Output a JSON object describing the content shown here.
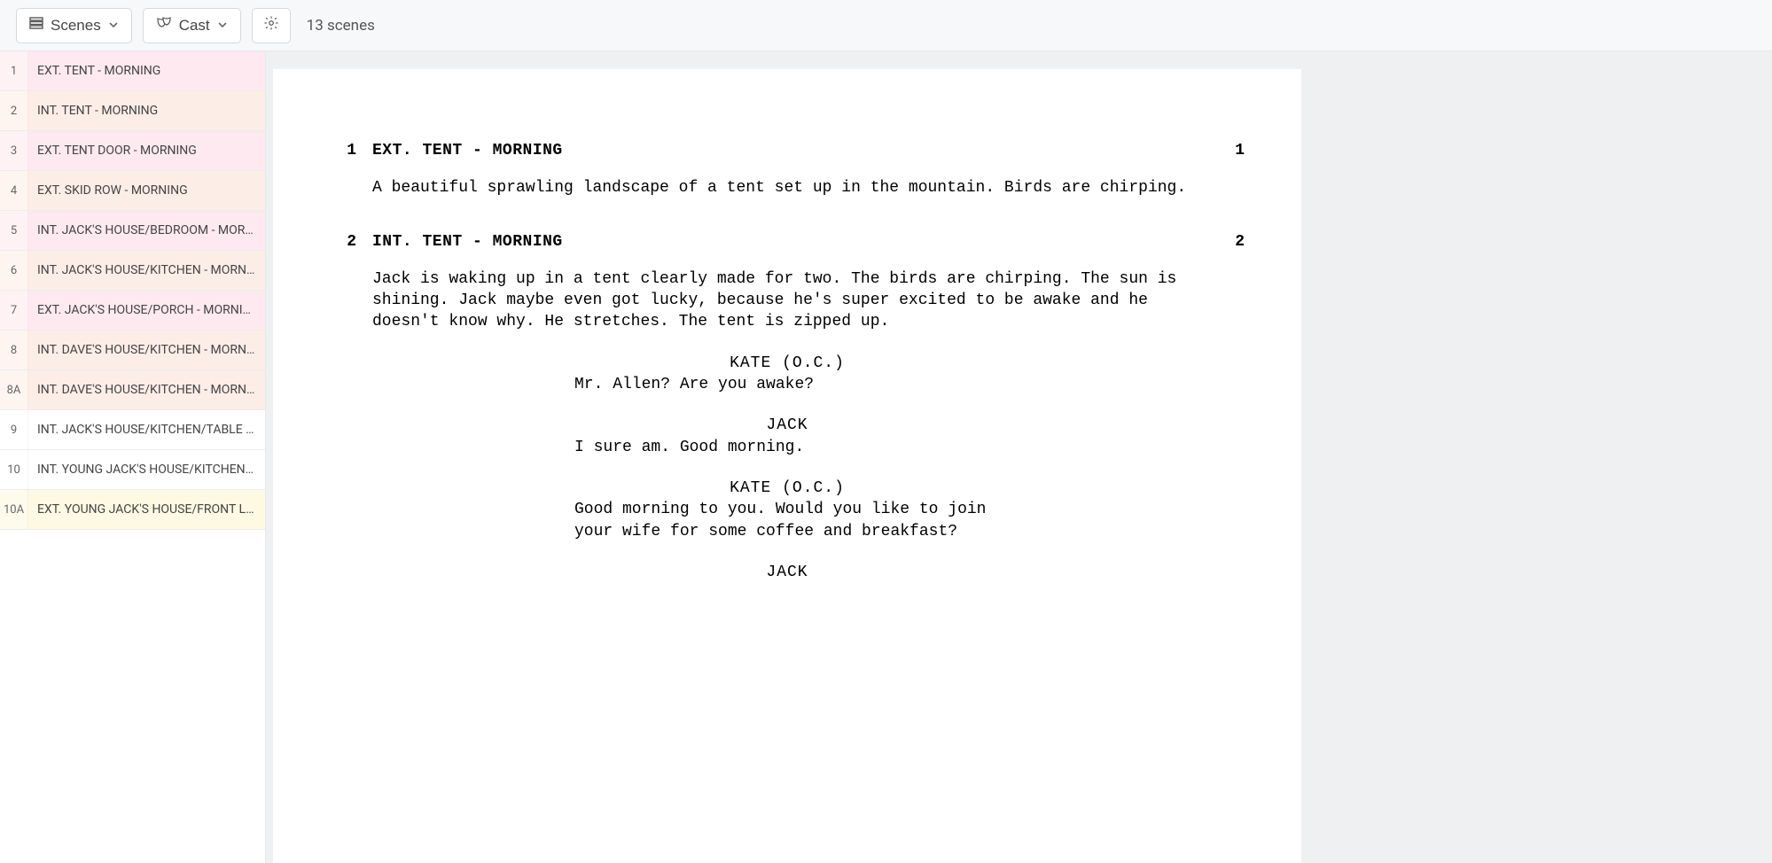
{
  "toolbar": {
    "scenes_label": "Scenes",
    "cast_label": "Cast",
    "scene_count": "13 scenes"
  },
  "sidebar": {
    "scenes": [
      {
        "num": "1",
        "title": "EXT. TENT - MORNING",
        "tint": "tint-pink-1"
      },
      {
        "num": "2",
        "title": "INT. TENT - MORNING",
        "tint": "tint-pink-2"
      },
      {
        "num": "3",
        "title": "EXT. TENT DOOR - MORNING",
        "tint": "tint-pink-1"
      },
      {
        "num": "4",
        "title": "EXT. SKID ROW - MORNING",
        "tint": "tint-pink-2"
      },
      {
        "num": "5",
        "title": "INT. JACK'S HOUSE/BEDROOM - MORNING",
        "tint": "tint-pink-1"
      },
      {
        "num": "6",
        "title": "INT. JACK'S HOUSE/KITCHEN - MORNING",
        "tint": "tint-pink-2"
      },
      {
        "num": "7",
        "title": "EXT. JACK'S HOUSE/PORCH - MORNING",
        "tint": "tint-pink-1"
      },
      {
        "num": "8",
        "title": "INT. DAVE'S HOUSE/KITCHEN - MORNING",
        "tint": "tint-pink-2"
      },
      {
        "num": "8A",
        "title": "INT. DAVE'S HOUSE/KITCHEN - MORNING",
        "tint": "tint-pink-2"
      },
      {
        "num": "9",
        "title": "INT. JACK'S HOUSE/KITCHEN/TABLE - DAY",
        "tint": "tint-white"
      },
      {
        "num": "10",
        "title": "INT. YOUNG JACK'S HOUSE/KITCHEN/TABLE - …",
        "tint": "tint-white"
      },
      {
        "num": "10A",
        "title": "EXT. YOUNG JACK'S HOUSE/FRONT LAWN - D…",
        "tint": "tint-yellow"
      }
    ]
  },
  "script": {
    "scenes": [
      {
        "num": "1",
        "slug": "EXT. TENT - MORNING",
        "content": [
          {
            "type": "action",
            "text": "A beautiful sprawling landscape of a tent set up in the mountain. Birds are chirping."
          }
        ]
      },
      {
        "num": "2",
        "slug": "INT. TENT - MORNING",
        "content": [
          {
            "type": "action",
            "text": "Jack is waking up in a tent clearly made for two. The birds are chirping. The sun is shining. Jack maybe even got lucky, because he's super excited to be awake and he doesn't know why. He stretches. The tent is zipped up."
          },
          {
            "type": "dialogue",
            "character": "KATE (O.C.)",
            "text": "Mr. Allen? Are you awake?"
          },
          {
            "type": "dialogue",
            "character": "JACK",
            "text": "I sure am. Good morning."
          },
          {
            "type": "dialogue",
            "character": "KATE (O.C.)",
            "text": "Good morning to you. Would you like to join your wife for some coffee and breakfast?"
          },
          {
            "type": "dialogue",
            "character": "JACK",
            "text": ""
          }
        ]
      }
    ]
  }
}
